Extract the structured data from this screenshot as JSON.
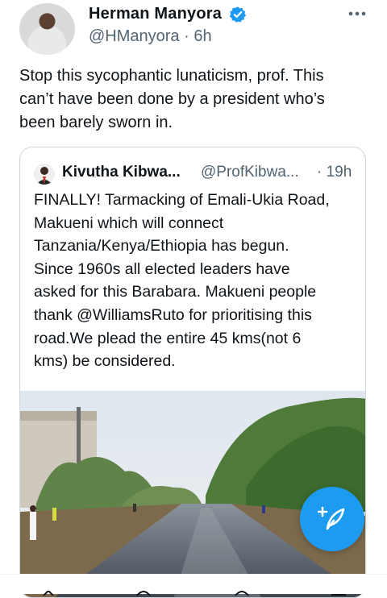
{
  "tweet": {
    "author_name": "Herman Manyora",
    "author_handle": "@HManyora · 6h",
    "text": "Stop this sycophantic lunaticism, prof. This\ncan’t have been done by a president who’s\nbeen barely sworn in."
  },
  "quote": {
    "author_name": "Kivutha Kibwa...",
    "author_handle": "@ProfKibwa...",
    "time": "· 19h",
    "text": "FINALLY! Tarmacking of Emali-Ukia Road,\nMakueni  which will connect\nTanzania/Kenya/Ethiopia has begun.\nSince 1960s all elected leaders have\nasked for this Barabara. Makueni people\nthank @WilliamsRuto for prioritising  this\nroad.We plead the entire 45 kms(not 6\nkms) be considered."
  },
  "icons": {
    "verified": "verified-badge-icon",
    "more": "more-options-icon",
    "compose": "compose-tweet-icon"
  },
  "colors": {
    "accent": "#1d9bf0",
    "secondary_text": "#536471",
    "border": "#cfd9de"
  }
}
